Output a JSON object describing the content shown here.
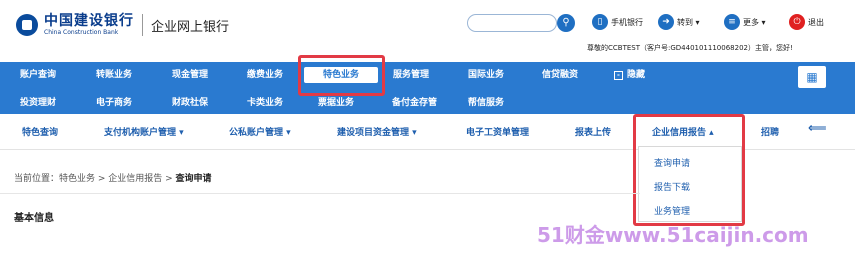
{
  "header": {
    "logo_cn": "中国建设银行",
    "logo_en": "China Construction Bank",
    "subtitle": "企业网上银行",
    "tools": [
      {
        "label": "手机银行",
        "color": "#1f6fc2"
      },
      {
        "label": "转到 ▾",
        "color": "#1f6fc2"
      },
      {
        "label": "更多 ▾",
        "color": "#1f6fc2"
      },
      {
        "label": "退出",
        "color": "#e02020"
      }
    ],
    "user_info": "尊敬的CCBTEST（客户号:GD440101110068202）主管，您好!"
  },
  "nav": {
    "row1": [
      "账户查询",
      "转账业务",
      "现金管理",
      "缴费业务",
      "特色业务",
      "服务管理",
      "国际业务",
      "信贷融资",
      "隐藏"
    ],
    "row2": [
      "投资理财",
      "电子商务",
      "财政社保",
      "卡类业务",
      "票据业务",
      "备付金存管",
      "帮信服务"
    ],
    "grid_icon": "grid-icon"
  },
  "subnav": {
    "items": [
      "特色查询",
      "支付机构账户管理 ▾",
      "公私账户管理 ▾",
      "建设项目资金管理 ▾",
      "电子工资单管理",
      "报表上传",
      "企业信用报告 ▴",
      "招聘",
      "⟸"
    ]
  },
  "dropdown": {
    "items": [
      "查询申请",
      "报告下载",
      "业务管理"
    ]
  },
  "breadcrumb": {
    "prefix": "当前位置：特色业务 > 企业信用报告 > ",
    "current": "查询申请"
  },
  "section": {
    "title": "基本信息"
  },
  "watermark": "51财金www.51caijin.com"
}
